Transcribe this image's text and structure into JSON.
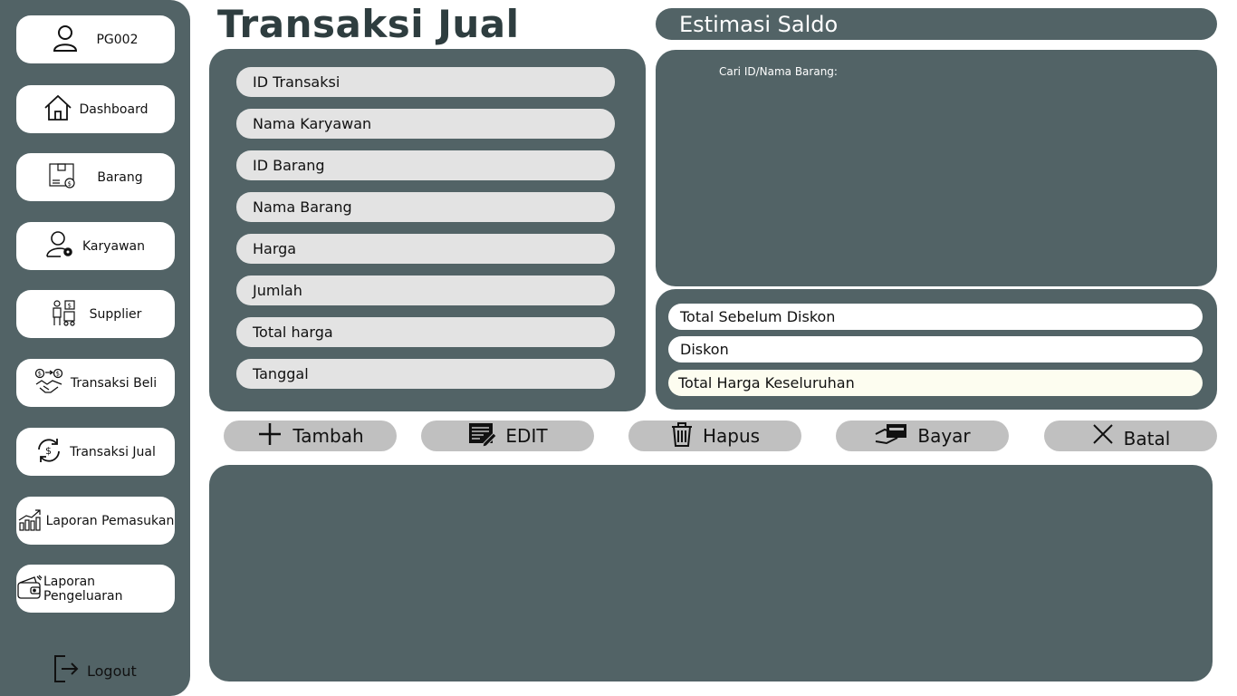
{
  "sidebar": {
    "user": {
      "label": "PG002",
      "icon": "user-icon"
    },
    "items": [
      {
        "label": "Dashboard",
        "icon": "home-icon"
      },
      {
        "label": "Barang",
        "icon": "box-icon"
      },
      {
        "label": "Karyawan",
        "icon": "user-gear-icon"
      },
      {
        "label": "Supplier",
        "icon": "supplier-icon"
      },
      {
        "label": "Transaksi Beli",
        "icon": "handshake-icon"
      },
      {
        "label": "Transaksi Jual",
        "icon": "exchange-icon"
      },
      {
        "label": "Laporan Pemasukan",
        "icon": "growth-chart-icon"
      },
      {
        "label": "Laporan Pengeluaran",
        "icon": "wallet-icon"
      }
    ],
    "logout": {
      "label": "Logout",
      "icon": "logout-icon"
    }
  },
  "header": {
    "title": "Transaksi Jual"
  },
  "form": {
    "fields": [
      {
        "placeholder": "ID Transaksi"
      },
      {
        "placeholder": "Nama Karyawan"
      },
      {
        "placeholder": "ID Barang"
      },
      {
        "placeholder": "Nama Barang"
      },
      {
        "placeholder": "Harga"
      },
      {
        "placeholder": "Jumlah"
      },
      {
        "placeholder": "Total harga"
      },
      {
        "placeholder": "Tanggal"
      }
    ]
  },
  "saldo": {
    "title": "Estimasi Saldo"
  },
  "search": {
    "label": "Cari ID/Nama Barang:"
  },
  "summary": {
    "fields": [
      {
        "placeholder": "Total Sebelum Diskon"
      },
      {
        "placeholder": "Diskon"
      },
      {
        "placeholder": "Total Harga Keseluruhan"
      }
    ]
  },
  "actions": {
    "tambah": {
      "label": "Tambah",
      "icon": "plus-icon"
    },
    "edit": {
      "label": "EDIT",
      "icon": "edit-list-icon"
    },
    "hapus": {
      "label": "Hapus",
      "icon": "trash-icon"
    },
    "bayar": {
      "label": "Bayar",
      "icon": "card-payment-icon"
    },
    "batal": {
      "label": "Batal",
      "icon": "close-icon"
    }
  },
  "colors": {
    "panel": "#526366",
    "field": "#e3e3e3",
    "button": "#c0c0c0",
    "title": "#2e3d3f",
    "total_highlight": "#fdfdf0"
  }
}
